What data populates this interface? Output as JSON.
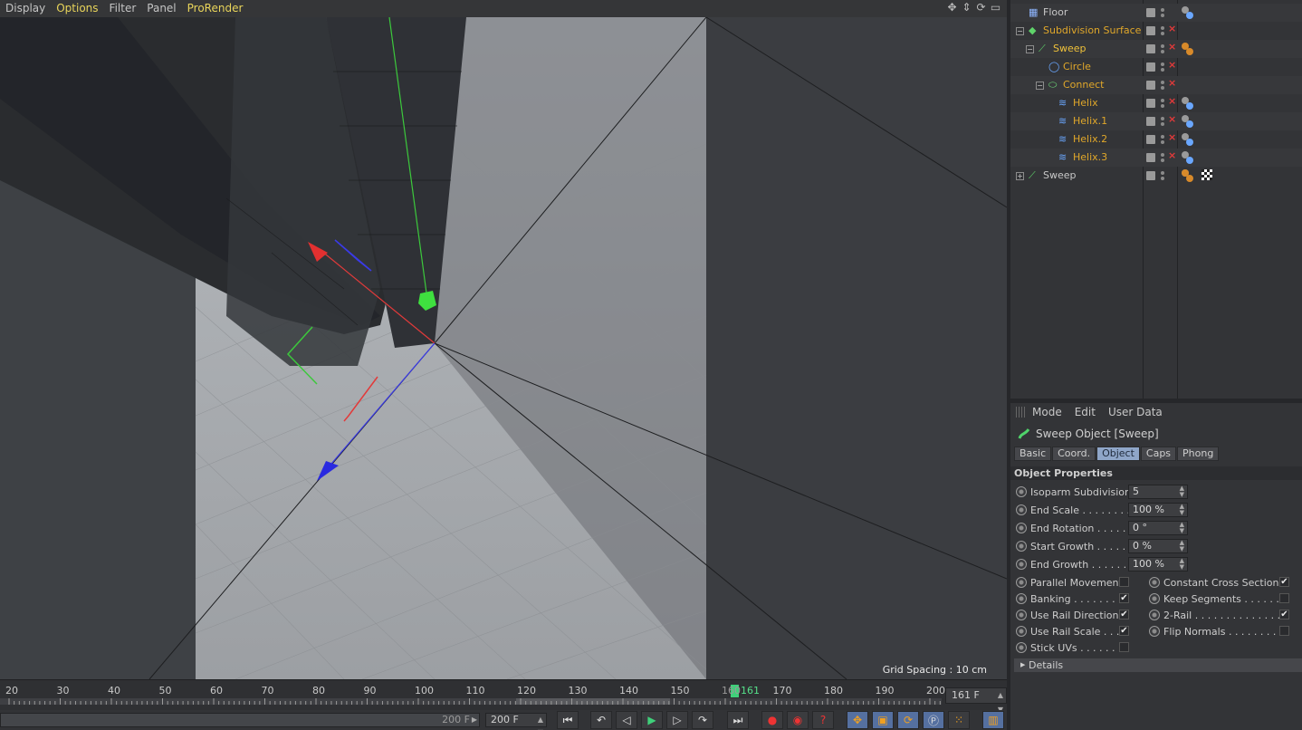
{
  "menubar": {
    "items": [
      {
        "label": "Display",
        "highlight": false
      },
      {
        "label": "Options",
        "highlight": true
      },
      {
        "label": "Filter",
        "highlight": false
      },
      {
        "label": "Panel",
        "highlight": false
      },
      {
        "label": "ProRender",
        "highlight": true
      }
    ],
    "nav_icons": [
      "move-view-icon",
      "zoom-view-icon",
      "rotate-view-icon",
      "maximize-view-icon"
    ]
  },
  "viewport": {
    "grid_spacing": "Grid Spacing : 10 cm"
  },
  "timeline": {
    "ticks": [
      "20",
      "30",
      "40",
      "50",
      "60",
      "70",
      "80",
      "90",
      "100",
      "110",
      "120",
      "130",
      "140",
      "150",
      "160",
      "170",
      "180",
      "190",
      "200"
    ],
    "current_frame_marker": "161",
    "current_frame_field": "161 F"
  },
  "transport": {
    "range_end": "200 F",
    "max_frame": "200 F",
    "buttons": [
      "go-to-start",
      "go-to-previous-key",
      "step-back",
      "play",
      "step-forward",
      "go-to-next-key",
      "go-to-end",
      "record",
      "autokey",
      "keyframe-selection",
      "move-key",
      "scale-key",
      "rotate-key",
      "parameter-key",
      "point-level-key",
      "timeline-window"
    ]
  },
  "object_manager": {
    "rows": [
      {
        "name": "Floor",
        "color": "#c8c8c8",
        "indent": 0
      },
      {
        "name": "Subdivision Surface",
        "color": "#e0a72a",
        "indent": 0
      },
      {
        "name": "Sweep",
        "color": "#f0c23a",
        "indent": 1
      },
      {
        "name": "Circle",
        "color": "#e0a72a",
        "indent": 2
      },
      {
        "name": "Connect",
        "color": "#e0a72a",
        "indent": 2
      },
      {
        "name": "Helix",
        "color": "#e0a72a",
        "indent": 3
      },
      {
        "name": "Helix.1",
        "color": "#e0a72a",
        "indent": 3
      },
      {
        "name": "Helix.2",
        "color": "#e0a72a",
        "indent": 3
      },
      {
        "name": "Helix.3",
        "color": "#e0a72a",
        "indent": 3
      },
      {
        "name": "Sweep",
        "color": "#c8c8c8",
        "indent": 0
      }
    ]
  },
  "attributes": {
    "menu": [
      "Mode",
      "Edit",
      "User Data"
    ],
    "title": "Sweep Object [Sweep]",
    "tabs": [
      {
        "label": "Basic",
        "active": false
      },
      {
        "label": "Coord.",
        "active": false
      },
      {
        "label": "Object",
        "active": true
      },
      {
        "label": "Caps",
        "active": false
      },
      {
        "label": "Phong",
        "active": false
      }
    ],
    "section": "Object Properties",
    "fields": [
      {
        "label": "Isoparm Subdivision",
        "value": "5"
      },
      {
        "label": "End Scale . . . . . . . . .",
        "value": "100 %"
      },
      {
        "label": "End Rotation . . . . . .",
        "value": "0 °"
      },
      {
        "label": "Start Growth . . . . . .",
        "value": "0 %"
      },
      {
        "label": "End Growth . . . . . . .",
        "value": "100 %"
      }
    ],
    "checks_left": [
      {
        "label": "Parallel Movement",
        "checked": false
      },
      {
        "label": "Banking . . . . . . . . .",
        "checked": true
      },
      {
        "label": "Use Rail Direction",
        "checked": true
      },
      {
        "label": "Use Rail Scale . . .",
        "checked": true
      },
      {
        "label": "Stick UVs . . . . . . . .",
        "checked": false
      }
    ],
    "checks_right": [
      {
        "label": "Constant Cross Section",
        "checked": true
      },
      {
        "label": "Keep Segments . . . . . . .",
        "checked": false
      },
      {
        "label": "2-Rail . . . . . . . . . . . . . . .",
        "checked": true
      },
      {
        "label": "Flip Normals . . . . . . . . .",
        "checked": false
      }
    ],
    "details": "Details"
  }
}
